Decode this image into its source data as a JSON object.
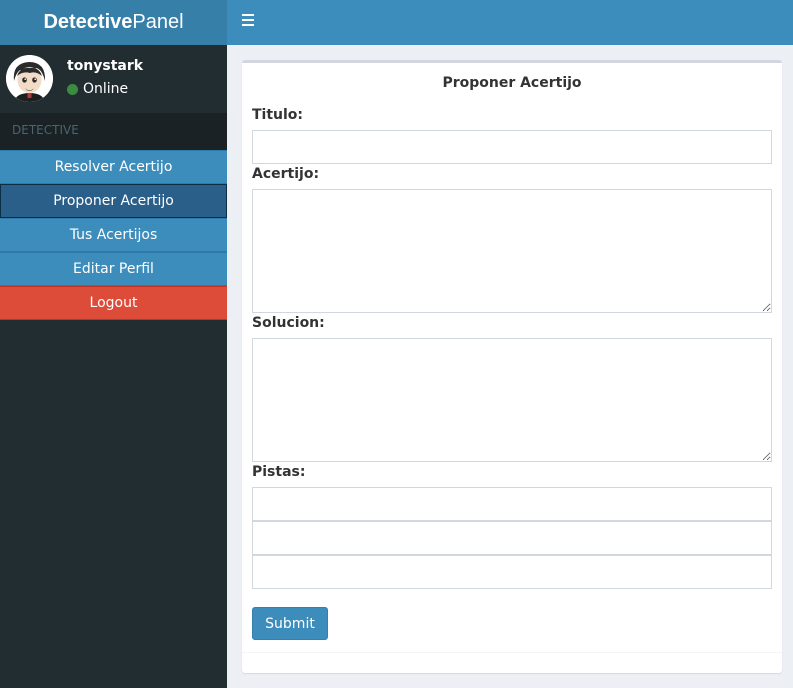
{
  "brand": {
    "bold": "Detective",
    "light": "Panel"
  },
  "user": {
    "name": "tonystark",
    "status": "Online"
  },
  "sidebar": {
    "section_header": "DETECTIVE",
    "items": [
      {
        "label": "Resolver Acertijo",
        "icon": "none",
        "active": false
      },
      {
        "label": "Proponer Acertijo",
        "icon": "none",
        "active": true
      },
      {
        "label": "Tus Acertijos",
        "icon": "none",
        "active": false
      },
      {
        "label": "Editar Perfil",
        "icon": "none",
        "active": false
      },
      {
        "label": "Logout",
        "icon": "none",
        "active": false
      }
    ]
  },
  "topbar": {
    "toggle_icon": "hamburger-icon"
  },
  "form": {
    "title": "Proponer Acertijo",
    "titulo_label": "Titulo:",
    "titulo_value": "",
    "acertijo_label": "Acertijo:",
    "acertijo_value": "",
    "solucion_label": "Solucion:",
    "solucion_value": "",
    "pistas_label": "Pistas:",
    "pistas_values": [
      "",
      "",
      ""
    ],
    "submit_label": "Submit"
  },
  "colors": {
    "sidebar_bg": "#222d32",
    "brand_bg": "#367fa9",
    "topbar_bg": "#3c8dbc",
    "menu_item_bg": "#3c8dbc",
    "menu_active_bg": "#2a5f8a",
    "logout_bg": "#dd4b39",
    "content_bg": "#ecf0f5",
    "status_online": "#3d8b40"
  }
}
